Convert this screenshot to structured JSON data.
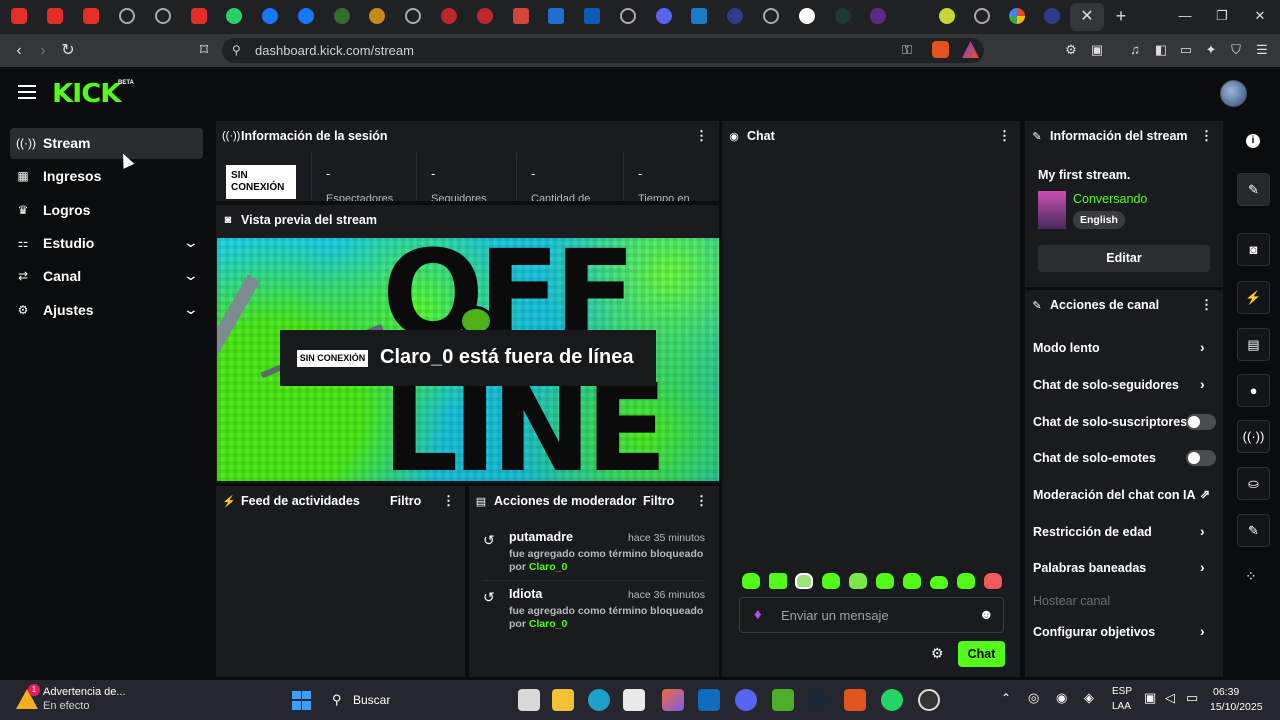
{
  "browser": {
    "url": "dashboard.kick.com/stream",
    "close_tab_glyph": "✕",
    "new_tab_glyph": "+"
  },
  "app": {
    "logo": "KICK",
    "beta": "BETA"
  },
  "sidebar": {
    "items": [
      {
        "label": "Stream",
        "icon": "broadcast-icon"
      },
      {
        "label": "Ingresos",
        "icon": "chart-icon"
      },
      {
        "label": "Logros",
        "icon": "trophy-icon"
      },
      {
        "label": "Estudio",
        "icon": "studio-icon"
      },
      {
        "label": "Canal",
        "icon": "channel-icon"
      },
      {
        "label": "Ajustes",
        "icon": "gear-icon"
      }
    ]
  },
  "session": {
    "title": "Información de la sesión",
    "status_badge": "SIN CONEXIÓN",
    "stats": [
      {
        "value": "-",
        "label": "Espectadores"
      },
      {
        "value": "-",
        "label": "Seguidores"
      },
      {
        "value": "-",
        "label": "Cantidad de"
      },
      {
        "value": "-",
        "label": "Tiempo en"
      }
    ]
  },
  "preview": {
    "title": "Vista previa del stream",
    "badge": "SIN CONEXIÓN",
    "message": "Claro_0 está fuera de línea",
    "art_text_top": "OFF",
    "art_text_bottom": "LINE"
  },
  "feed": {
    "title": "Feed de actividades",
    "filter": "Filtro"
  },
  "mod_actions": {
    "title": "Acciones de moderador",
    "filter": "Filtro",
    "items": [
      {
        "term": "putamadre",
        "time": "hace 35 minutos",
        "desc": "fue agregado como término bloqueado",
        "by_prefix": "por",
        "by": "Claro_0"
      },
      {
        "term": "Idiota",
        "time": "hace 36 minutos",
        "desc": "fue agregado como término bloqueado",
        "by_prefix": "por",
        "by": "Claro_0"
      }
    ]
  },
  "chat": {
    "title": "Chat",
    "placeholder": "Enviar un mensaje",
    "send_label": "Chat"
  },
  "stream_info": {
    "title": "Información del stream",
    "stream_title": "My first stream.",
    "category": "Conversando",
    "language": "English",
    "edit_label": "Editar"
  },
  "channel_actions": {
    "title": "Acciones de canal",
    "items": [
      {
        "label": "Modo lento",
        "control": "chevron"
      },
      {
        "label": "Chat de solo-seguidores",
        "control": "chevron"
      },
      {
        "label": "Chat de solo-suscriptores",
        "control": "toggle",
        "on": false
      },
      {
        "label": "Chat de solo-emotes",
        "control": "toggle",
        "on": false
      },
      {
        "label": "Moderación del chat con IA",
        "control": "external"
      },
      {
        "label": "Restricción de edad",
        "control": "chevron"
      },
      {
        "label": "Palabras baneadas",
        "control": "chevron"
      },
      {
        "label": "Hostear canal",
        "control": "none",
        "disabled": true
      },
      {
        "label": "Configurar objetivos",
        "control": "chevron"
      }
    ]
  },
  "taskbar": {
    "warning_title": "Advertencia de...",
    "warning_sub": "En efecto",
    "warning_count": "1",
    "search": "Buscar",
    "lang_1": "ESP",
    "lang_2": "LAA",
    "time": "06:39",
    "date": "15/10/2025"
  },
  "colors": {
    "accent": "#53fc18",
    "panel": "#191b1f",
    "background": "#0b0c0d"
  }
}
